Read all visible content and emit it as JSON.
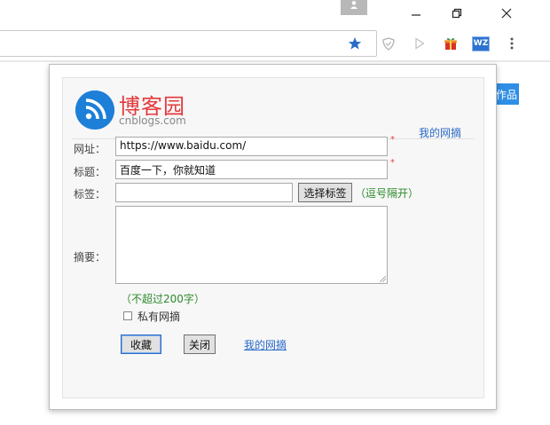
{
  "window": {
    "minimize_icon": "minimize-icon",
    "restore_icon": "restore-icon",
    "close_icon": "close-icon",
    "user_icon": "user-icon"
  },
  "toolbar": {
    "bookmark_star_color": "#2a6ac8",
    "extensions": [
      "shield-icon",
      "play-icon",
      "gift-icon",
      "wz-icon"
    ],
    "wz_label": "WZ",
    "menu_icon": "menu-dots-icon"
  },
  "side_tab": {
    "label": "作品"
  },
  "popup": {
    "brand": {
      "name_cn": "博客园",
      "name_en": "cnblogs.com",
      "logo_color": "#1d7fd8"
    },
    "header_link": "我的网摘",
    "form": {
      "url_label": "网址：",
      "url_value": "https://www.baidu.com/",
      "title_label": "标题：",
      "title_value": "百度一下，你就知道",
      "tags_label": "标签：",
      "tags_value": "",
      "choose_tags_button": "选择标签",
      "tags_hint": "（逗号隔开）",
      "summary_label": "摘要：",
      "summary_value": "",
      "summary_hint": "（不超过200字）",
      "private_label": "私有网摘",
      "private_checked": false,
      "required_mark": "*"
    },
    "actions": {
      "save_button": "收藏",
      "close_button": "关闭",
      "my_link": "我的网摘"
    }
  }
}
